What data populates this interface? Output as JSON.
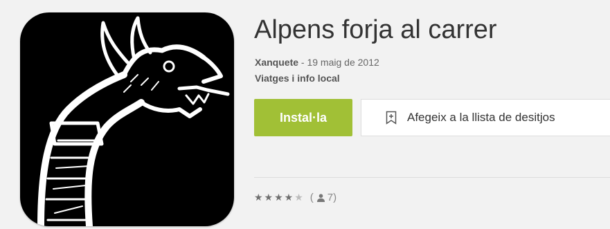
{
  "app": {
    "title": "Alpens forja al carrer",
    "developer": "Xanquete",
    "date_separator": " - ",
    "date": "19 maig de 2012",
    "category": "Viatges i info local"
  },
  "actions": {
    "install_label": "Instal·la",
    "wishlist_label": "Afegeix a la llista de desitjos"
  },
  "rating": {
    "stars_full": "★★★★",
    "stars_half": "★",
    "value": 4.5,
    "count_open": "(",
    "count": "7",
    "count_close": ")"
  },
  "colors": {
    "install": "#a1c036",
    "background": "#f2f2f2",
    "icon_bg": "#000000"
  },
  "icons": {
    "app_icon": "dragon-head-icon",
    "wishlist": "bookmark-plus-icon",
    "rater": "person-icon"
  }
}
